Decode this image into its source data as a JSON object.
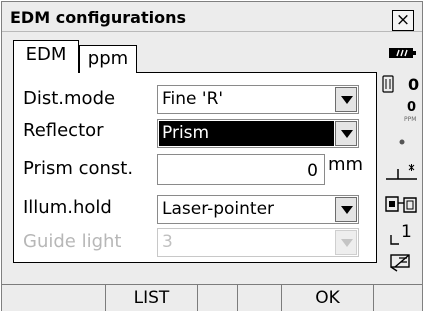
{
  "window": {
    "title": "EDM configurations",
    "close_glyph": "×"
  },
  "tabs": [
    {
      "label": "EDM",
      "active": true
    },
    {
      "label": "ppm",
      "active": false
    }
  ],
  "form": {
    "dist_mode": {
      "label": "Dist.mode",
      "value": "Fine 'R'"
    },
    "reflector": {
      "label": "Reflector",
      "value": "Prism"
    },
    "prism_const": {
      "label": "Prism const.",
      "value": "0",
      "unit": "mm"
    },
    "illum_hold": {
      "label": "Illum.hold",
      "value": "Laser-pointer"
    },
    "guide_light": {
      "label": "Guide light",
      "value": "3"
    }
  },
  "status": {
    "zero_a": "0",
    "zero_b": "0",
    "ppm_label": "PPM",
    "one": "1"
  },
  "softkeys": [
    "",
    "LIST",
    "",
    "",
    "OK",
    ""
  ],
  "colors": {
    "selected_bg": "#000000",
    "disabled_text": "#b7b7b7"
  }
}
